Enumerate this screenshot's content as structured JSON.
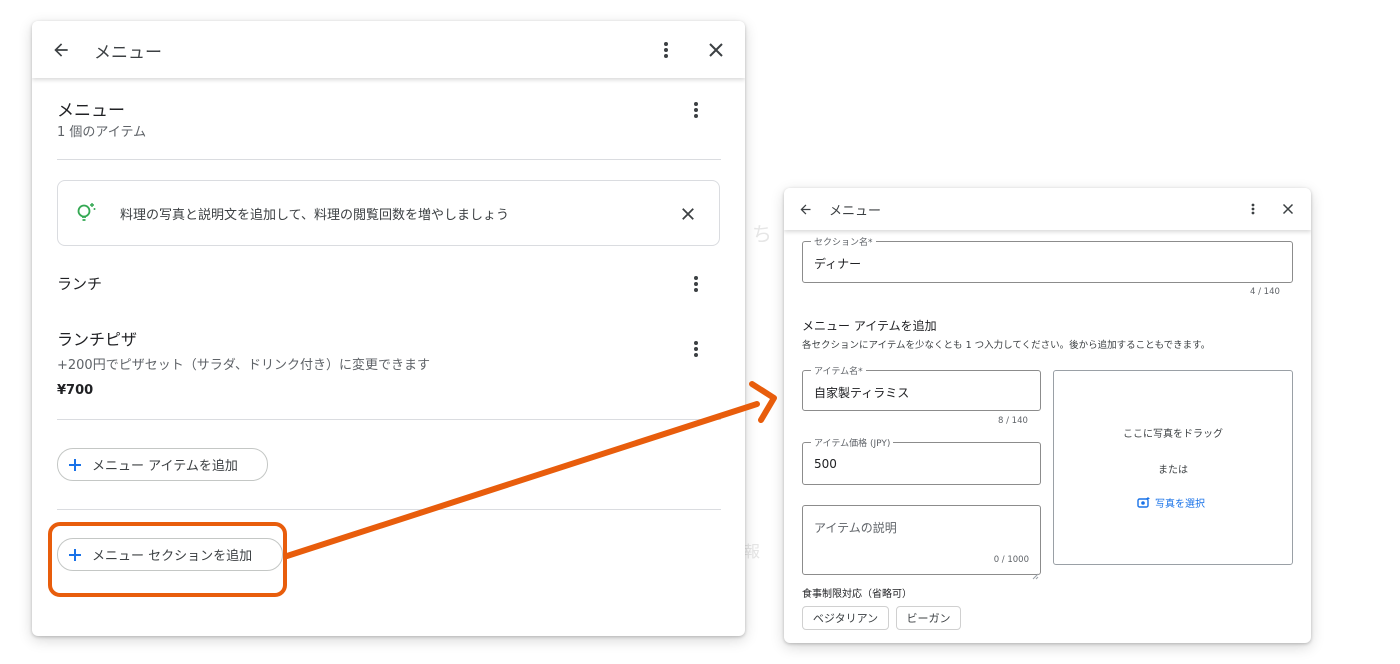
{
  "left_panel": {
    "header_title": "メニュー",
    "menu_title": "メニュー",
    "item_count": "1 個のアイテム",
    "tip_text": "料理の写真と説明文を追加して、料理の閲覧回数を増やしましょう",
    "section_name": "ランチ",
    "item": {
      "name": "ランチピザ",
      "description": "+200円でピザセット（サラダ、ドリンク付き）に変更できます",
      "price": "¥700"
    },
    "add_item_label": "メニュー アイテムを追加",
    "add_section_label": "メニュー セクションを追加"
  },
  "right_panel": {
    "header_title": "メニュー",
    "section_name_label": "セクション名*",
    "section_name_value": "ディナー",
    "section_name_counter": "4 / 140",
    "add_items_heading": "メニュー アイテムを追加",
    "add_items_hint": "各セクションにアイテムを少なくとも 1 つ入力してください。後から追加することもできます。",
    "item_name_label": "アイテム名*",
    "item_name_value": "自家製ティラミス",
    "item_name_counter": "8 / 140",
    "item_price_label": "アイテム価格 (JPY)",
    "item_price_value": "500",
    "item_desc_placeholder": "アイテムの説明",
    "item_desc_counter": "0 / 1000",
    "photo_drag_text": "ここに写真をドラッグ",
    "photo_or_text": "または",
    "photo_select_label": "写真を選択",
    "dietary_label": "食事制限対応（省略可）",
    "dietary_options": [
      "ベジタリアン",
      "ビーガン"
    ]
  },
  "colors": {
    "highlight_orange": "#e85d0c",
    "accent_blue": "#1a73e8",
    "tip_green": "#34a853"
  },
  "icons": [
    "back-arrow-icon",
    "more-vert-icon",
    "close-icon",
    "lightbulb-icon",
    "plus-icon",
    "add-photo-icon"
  ]
}
